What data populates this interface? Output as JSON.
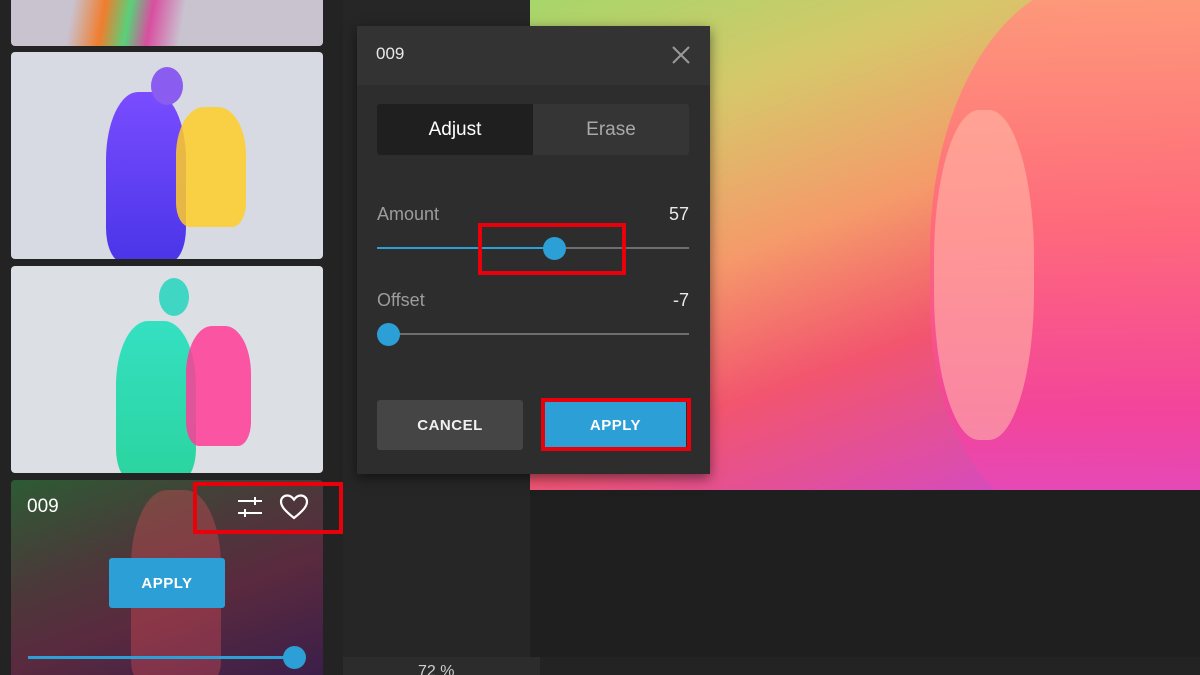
{
  "sidebar": {
    "active_filter": {
      "name": "009",
      "apply_label": "APPLY",
      "strength": 1.0
    }
  },
  "dialog": {
    "title": "009",
    "tabs": [
      {
        "label": "Adjust",
        "active": true
      },
      {
        "label": "Erase",
        "active": false
      }
    ],
    "sliders": [
      {
        "label": "Amount",
        "value": "57",
        "fraction": 0.57
      },
      {
        "label": "Offset",
        "value": "-7",
        "fraction": 0.0
      }
    ],
    "cancel_label": "CANCEL",
    "apply_label": "APPLY"
  },
  "zoom": {
    "value": "72 %"
  },
  "icons": {
    "close": "close-icon",
    "adjust": "sliders-icon",
    "favorite": "heart-icon"
  },
  "colors": {
    "accent": "#2b9fd6",
    "highlight": "#e8000b",
    "panel": "#2d2d2d",
    "background": "#1f1f1f"
  }
}
